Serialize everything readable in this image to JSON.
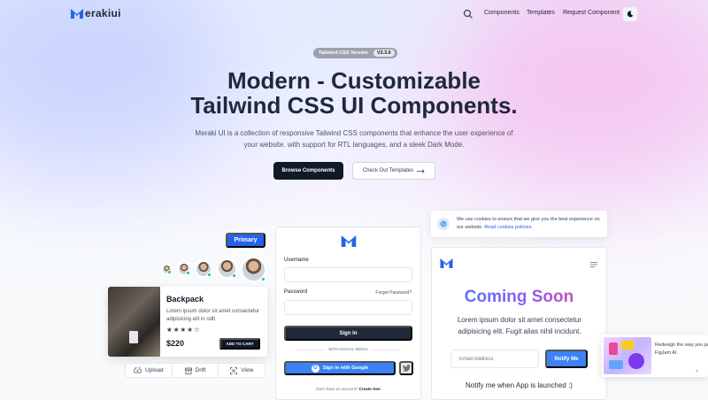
{
  "header": {
    "logo_text": "erakiui",
    "nav": [
      "Components",
      "Templates",
      "Request Component"
    ]
  },
  "hero": {
    "version_label": "Tailwind CSS Version",
    "version_number": "V3.3.6",
    "title_line1": "Modern - Customizable",
    "title_line2": "Tailwind CSS UI Components.",
    "description": "Meraki UI is a collection of responsive Tailwind CSS components that enhance the user experience of your website. with support for RTL languages, and a sleek Dark Mode.",
    "browse_label": "Browse Components",
    "templates_label": "Check Out Templates"
  },
  "components": {
    "primary_button": "Primary",
    "product": {
      "title": "Backpack",
      "description": "Lorem ipsum dolor sit amet consectetur adipisicing elit in odit",
      "rating": 4,
      "rating_max": 5,
      "price": "$220",
      "add_to_cart": "ADD TO CART"
    },
    "button_group": [
      "Upload",
      "Drift",
      "View"
    ]
  },
  "login": {
    "username_label": "Username",
    "password_label": "Password",
    "forgot_label": "Forget Password?",
    "signin_label": "Sign In",
    "social_label": "WITH SOCIAL MEDIA",
    "google_label": "Sign in with Google",
    "no_account_text": "Don't have an account?",
    "create_label": "Create One"
  },
  "cookie": {
    "text": "We use cookies to ensure that we give you the best experience on our website.",
    "link": "Read cookies policies."
  },
  "coming_soon": {
    "title": "Coming Soon",
    "description": "Lorem ipsum dolor sit amet consectetur adipisicing elit. Fugit alias nihil incidunt.",
    "email_placeholder": "Email Address",
    "notify_label": "Notify Me",
    "footer": "Notify me when App is launched :)"
  },
  "figma_toast": {
    "line1": "Redesign the way you ja",
    "line2": "FigJam AI."
  },
  "colors": {
    "brand_blue": "#2563eb",
    "dark": "#111827",
    "online": "#22c55e"
  }
}
